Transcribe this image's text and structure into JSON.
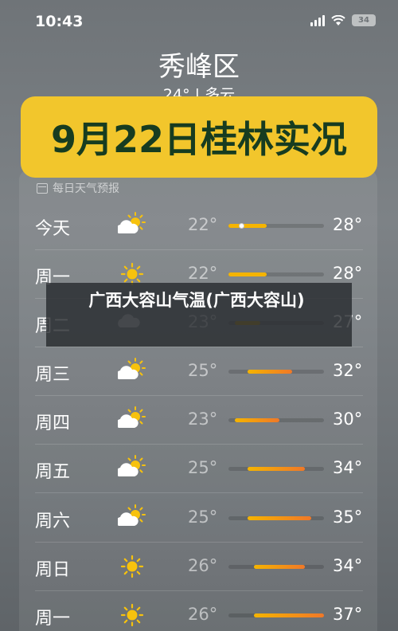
{
  "status_bar": {
    "time": "10:43",
    "battery": "34"
  },
  "location": {
    "city": "秀峰区",
    "current": "24° | 多云"
  },
  "banner": {
    "text": "9月22日桂林实况"
  },
  "forecast": {
    "header": "每日天气预报",
    "rows": [
      {
        "day": "今天",
        "icon": "partly-sunny-icon",
        "low": "22°",
        "high": "28°",
        "range": [
          22,
          28
        ],
        "current": 24
      },
      {
        "day": "周一",
        "icon": "sunny-icon",
        "low": "22°",
        "high": "28°",
        "range": [
          22,
          28
        ]
      },
      {
        "day": "周二",
        "icon": "cloud-icon",
        "low": "23°",
        "high": "27°",
        "range": [
          23,
          27
        ]
      },
      {
        "day": "周三",
        "icon": "partly-sunny-icon",
        "low": "25°",
        "high": "32°",
        "range": [
          25,
          32
        ]
      },
      {
        "day": "周四",
        "icon": "partly-sunny-icon",
        "low": "23°",
        "high": "30°",
        "range": [
          23,
          30
        ]
      },
      {
        "day": "周五",
        "icon": "partly-sunny-icon",
        "low": "25°",
        "high": "34°",
        "range": [
          25,
          34
        ]
      },
      {
        "day": "周六",
        "icon": "partly-sunny-icon",
        "low": "25°",
        "high": "35°",
        "range": [
          25,
          35
        ]
      },
      {
        "day": "周日",
        "icon": "sunny-icon",
        "low": "26°",
        "high": "34°",
        "range": [
          26,
          34
        ]
      },
      {
        "day": "周一",
        "icon": "sunny-icon",
        "low": "26°",
        "high": "37°",
        "range": [
          26,
          37
        ]
      }
    ]
  },
  "overlay": {
    "text": "广西大容山气温(广西大容山)"
  },
  "colors": {
    "banner": "#f2c62c",
    "banner_text": "#173c20",
    "cool": "#f5b400",
    "warm": "#f07828"
  }
}
